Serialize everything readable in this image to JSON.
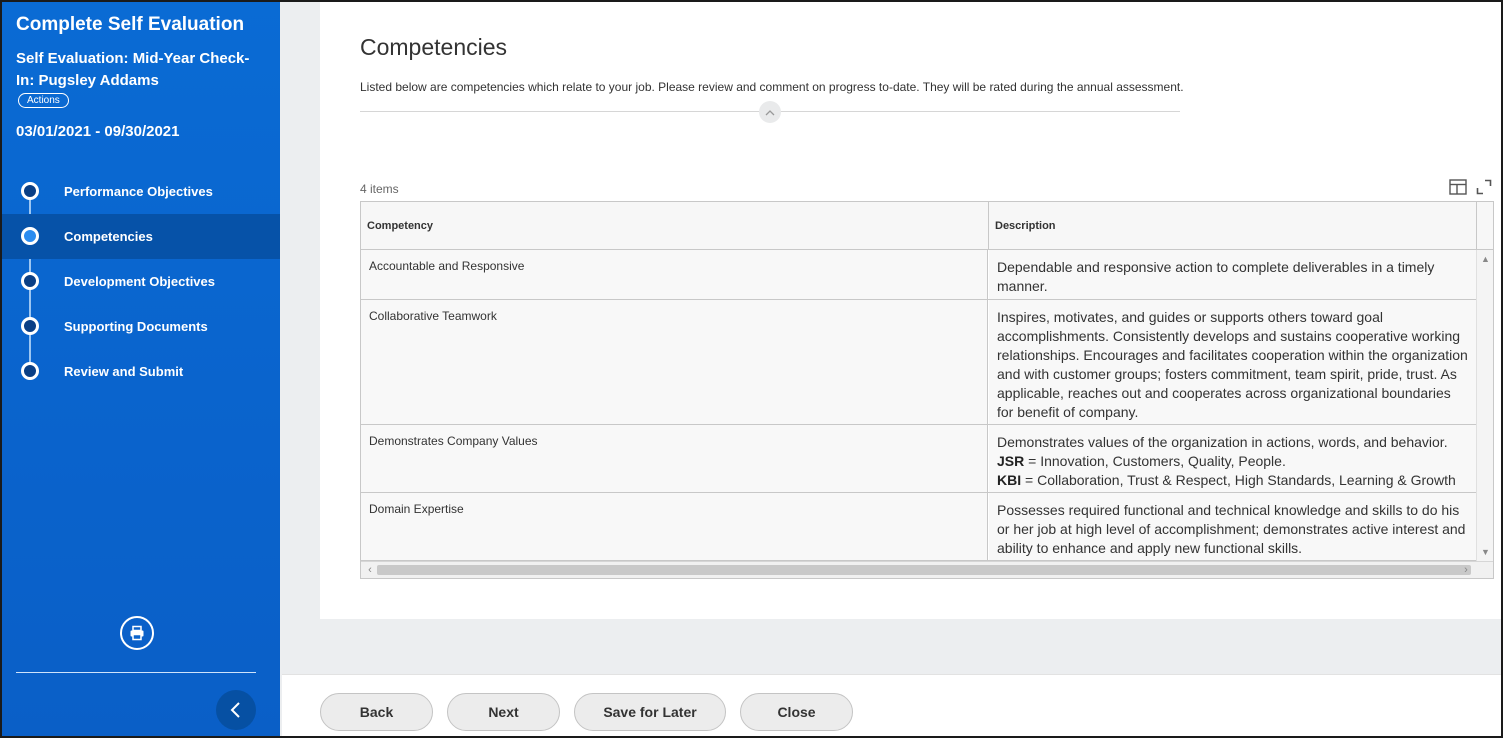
{
  "sidebar": {
    "title": "Complete Self Evaluation",
    "subtitle": "Self Evaluation: Mid-Year Check-In: Pugsley Addams",
    "actions_label": "Actions",
    "dates": "03/01/2021 - 09/30/2021",
    "steps": [
      {
        "label": "Performance Objectives",
        "active": false
      },
      {
        "label": "Competencies",
        "active": true
      },
      {
        "label": "Development Objectives",
        "active": false
      },
      {
        "label": "Supporting Documents",
        "active": false
      },
      {
        "label": "Review and Submit",
        "active": false
      }
    ],
    "icons": {
      "print": "print-icon",
      "collapse": "chevron-left-icon"
    }
  },
  "main": {
    "title": "Competencies",
    "intro": "Listed below are competencies which relate to your job. Please review and comment on progress to-date. They will be rated during the annual assessment.",
    "count": "4 items",
    "columns": [
      "Competency",
      "Description"
    ],
    "rows": [
      {
        "competency": "Accountable and Responsive",
        "description": "Dependable and responsive action to complete deliverables in a timely manner."
      },
      {
        "competency": "Collaborative Teamwork",
        "description": "Inspires, motivates, and guides or supports others toward goal accomplishments. Consistently develops and sustains cooperative working relationships. Encourages and facilitates cooperation within the organization and with customer groups; fosters commitment, team spirit, pride, trust. As applicable, reaches out and cooperates across organizational boundaries for benefit of company."
      },
      {
        "competency": "Demonstrates Company Values",
        "description_line1": "Demonstrates values of the organization in actions, words, and behavior.",
        "jsr_label": "JSR",
        "jsr_text": " = Innovation, Customers, Quality, People.",
        "kbi_label": "KBI",
        "kbi_text": " = Collaboration, Trust & Respect, High Standards, Learning & Growth"
      },
      {
        "competency": "Domain Expertise",
        "description": "Possesses required functional and technical knowledge and skills to do his or her job at high level of accomplishment; demonstrates active interest and ability to enhance and apply new functional skills."
      }
    ]
  },
  "footer": {
    "buttons": {
      "back": "Back",
      "next": "Next",
      "save": "Save for Later",
      "close": "Close"
    }
  },
  "colors": {
    "sidebar": "#0a6bd4",
    "active_step": "#0652a8"
  }
}
